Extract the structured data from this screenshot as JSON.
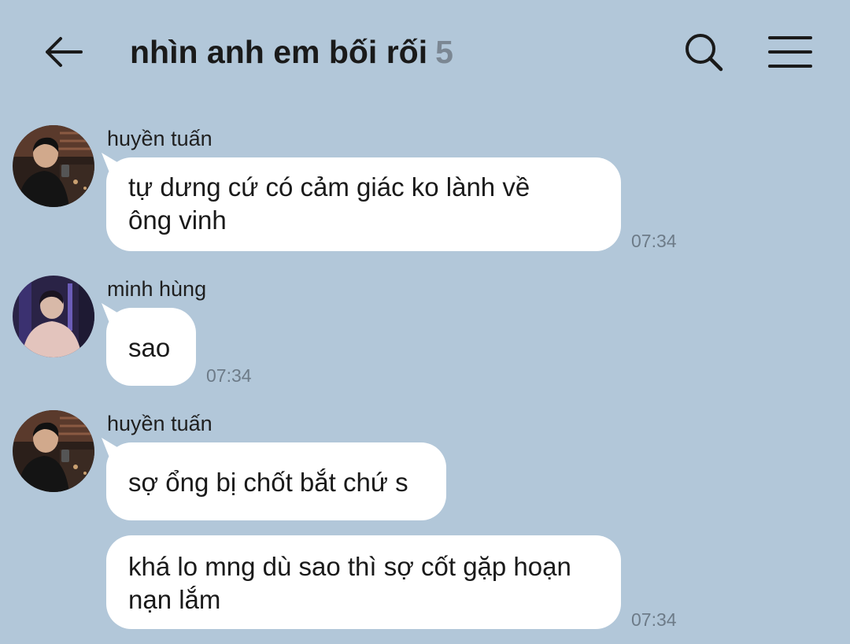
{
  "header": {
    "title": "nhìn anh em bối rối",
    "member_count": "5"
  },
  "messages": [
    {
      "sender": "huyền tuấn",
      "lines": [
        "tự dưng cứ có cảm giác ko lành về",
        "ông vinh"
      ],
      "time": "07:34"
    },
    {
      "sender": "minh hùng",
      "lines": [
        "sao"
      ],
      "time": "07:34"
    },
    {
      "sender": "huyền tuấn",
      "lines": [
        "sợ ổng bị chốt bắt chứ s"
      ],
      "time": ""
    },
    {
      "sender": "",
      "lines": [
        "khá lo mng dù sao thì sợ cốt gặp hoạn",
        "nạn lắm"
      ],
      "time": "07:34"
    }
  ],
  "colors": {
    "background": "#b2c7d9",
    "bubble": "#ffffff",
    "count": "#7b8793",
    "timestamp": "#6d7b88"
  },
  "icons": {
    "back": "arrow-left-icon",
    "search": "search-icon",
    "menu": "hamburger-menu-icon"
  }
}
